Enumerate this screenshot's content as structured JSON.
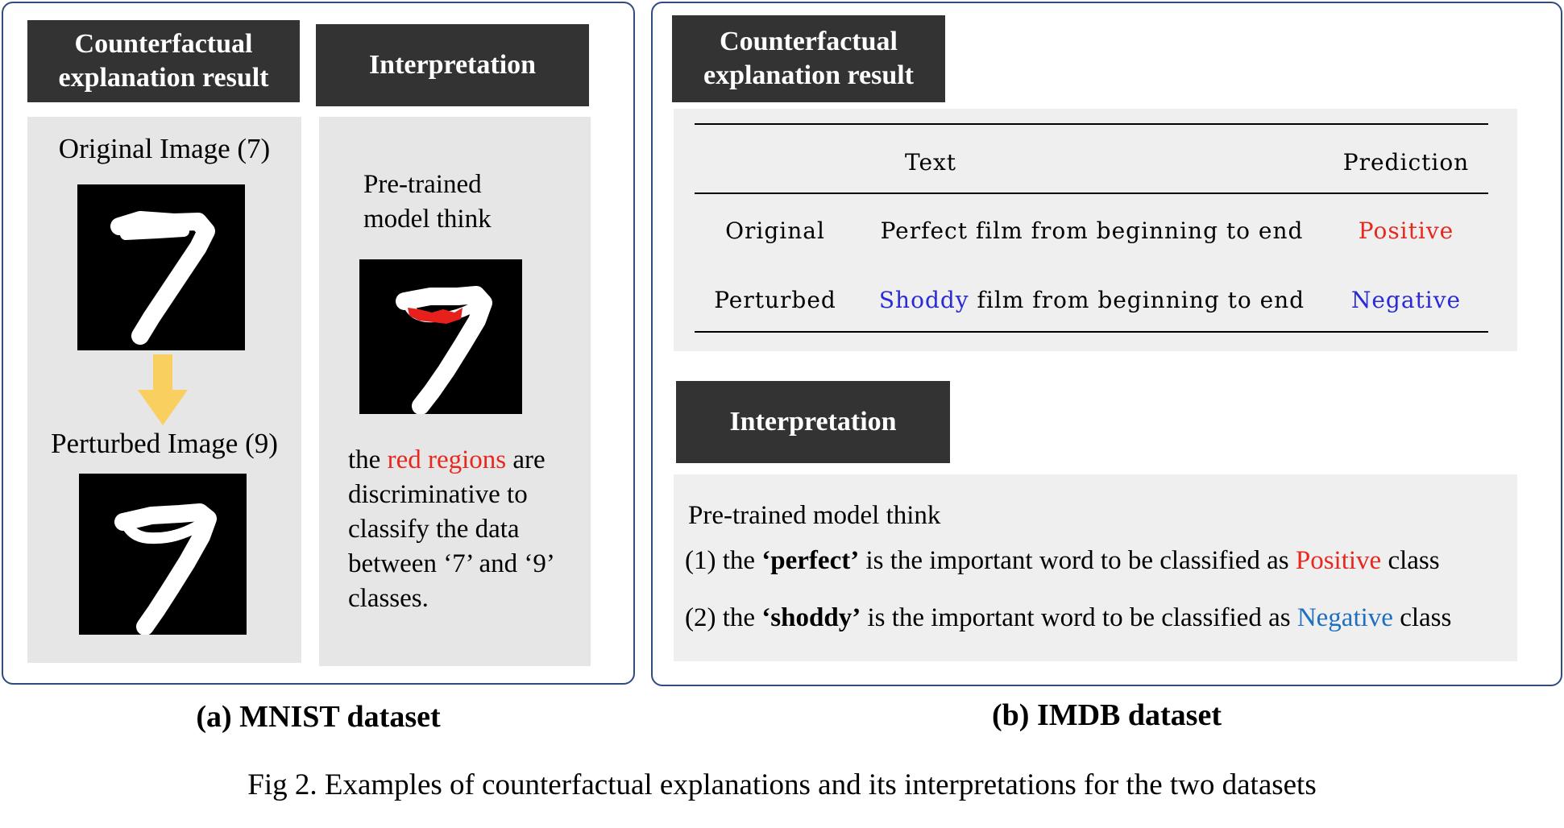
{
  "panel_a": {
    "header_result": "Counterfactual explanation result",
    "header_interp": "Interpretation",
    "original_label": "Original Image (7)",
    "perturbed_label": "Perturbed Image (9)",
    "pretrained_think": "Pre-trained model think",
    "interp_pre": "the",
    "interp_red": "red regions",
    "interp_post": "are discriminative to classify the data between ‘7’ and ‘9’ classes.",
    "caption": "(a) MNIST dataset",
    "arrow_color": "#f9d060",
    "highlight_color": "#e8201c"
  },
  "panel_b": {
    "header_result": "Counterfactual explanation result",
    "table": {
      "col_text": "Text",
      "col_pred": "Prediction",
      "rows": [
        {
          "label": "Original",
          "word": "",
          "rest": "Perfect film from beginning to end",
          "pred": "Positive"
        },
        {
          "label": "Perturbed",
          "word": "Shoddy",
          "rest": "film from beginning to end",
          "pred": "Negative"
        }
      ]
    },
    "header_interp": "Interpretation",
    "interp_title": "Pre-trained model think",
    "line1_pre": "(1) the",
    "line1_word": "‘perfect’",
    "line1_mid": "is the important word to be classified as",
    "line1_cls": "Positive",
    "line1_end": "class",
    "line2_pre": "(2) the",
    "line2_word": "‘shoddy’",
    "line2_mid": "is the important word to be classified as",
    "line2_cls": "Negative",
    "line2_end": "class",
    "caption": "(b) IMDB dataset",
    "positive_color": "#e8281e",
    "negative_color": "#2a2ad6"
  },
  "figure_caption": "Fig 2. Examples of counterfactual explanations and its interpretations for the two datasets"
}
